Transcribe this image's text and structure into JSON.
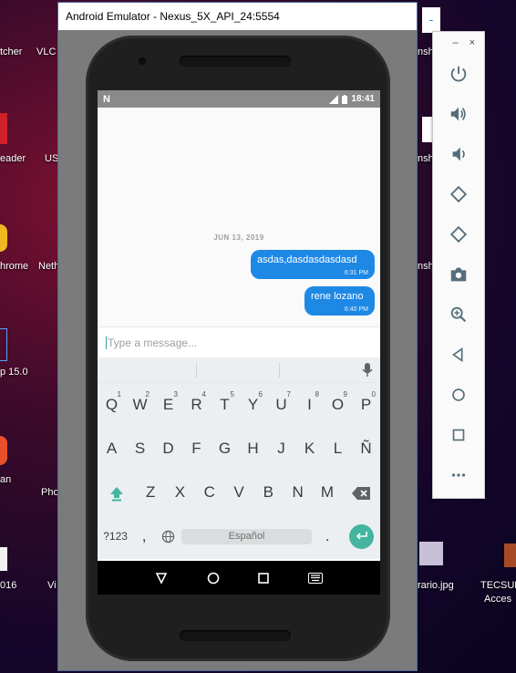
{
  "desktop": {
    "left_labels": [
      "tcher",
      "VLC",
      "eader",
      "US",
      "hrome",
      "Neth",
      "p 15.0",
      "an",
      "Pho",
      "016",
      "Vi"
    ],
    "right_labels": [
      "nsh",
      "nsh",
      "nsh",
      "rario.jpg",
      "TECSUP",
      "Acces"
    ]
  },
  "window": {
    "title": "Android Emulator - Nexus_5X_API_24:5554"
  },
  "statusbar": {
    "time": "18:41",
    "notification_icon": "n-logo-icon"
  },
  "chat": {
    "date_separator": "JUN 13, 2019",
    "messages": [
      {
        "text": "asdas,dasdasdasdasd",
        "time": "6:31 PM"
      },
      {
        "text": "rene lozano",
        "time": "6:40 PM"
      }
    ],
    "input_placeholder": "Type a message..."
  },
  "keyboard": {
    "row1": [
      {
        "key": "Q",
        "num": "1"
      },
      {
        "key": "W",
        "num": "2"
      },
      {
        "key": "E",
        "num": "3"
      },
      {
        "key": "R",
        "num": "4"
      },
      {
        "key": "T",
        "num": "5"
      },
      {
        "key": "Y",
        "num": "6"
      },
      {
        "key": "U",
        "num": "7"
      },
      {
        "key": "I",
        "num": "8"
      },
      {
        "key": "O",
        "num": "9"
      },
      {
        "key": "P",
        "num": "0"
      }
    ],
    "row2": [
      "A",
      "S",
      "D",
      "F",
      "G",
      "H",
      "J",
      "K",
      "L",
      "Ñ"
    ],
    "row3": [
      "Z",
      "X",
      "C",
      "V",
      "B",
      "N",
      "M"
    ],
    "symbols_label": "?123",
    "comma": ",",
    "space_label": "Español",
    "period": "."
  },
  "side_panel": {
    "minimize": "–",
    "close": "×",
    "buttons": [
      "power-icon",
      "volume-up-icon",
      "volume-down-icon",
      "rotate-left-icon",
      "rotate-right-icon",
      "camera-icon",
      "zoom-icon",
      "back-icon",
      "home-icon",
      "overview-icon",
      "more-icon"
    ]
  }
}
